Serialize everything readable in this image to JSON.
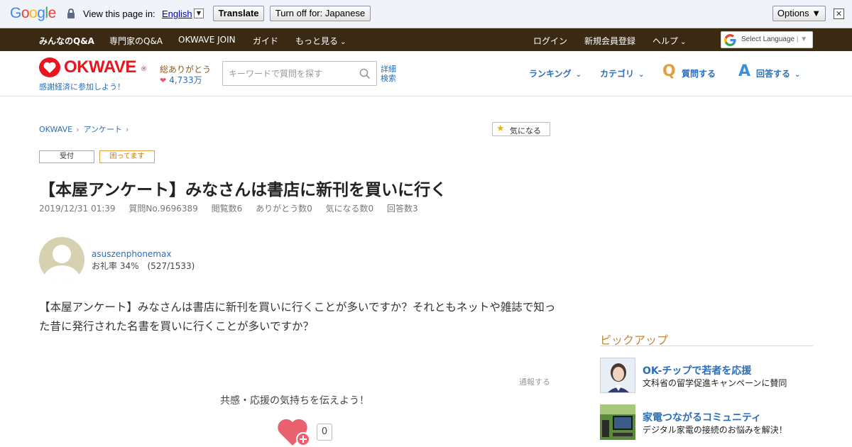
{
  "translate_bar": {
    "logo_letters": [
      "G",
      "o",
      "o",
      "g",
      "l",
      "e"
    ],
    "logo_colors": [
      "#4285f4",
      "#ea4335",
      "#fbbc05",
      "#4285f4",
      "#34a853",
      "#ea4335"
    ],
    "prompt": "View this page in:",
    "language": "English",
    "translate_label": "Translate",
    "turn_off_label": "Turn off for: Japanese",
    "options_label": "Options ▼",
    "close_glyph": "✕"
  },
  "topnav": {
    "items": [
      {
        "label": "みんなのQ&A"
      },
      {
        "label": "専門家のQ&A"
      },
      {
        "label": "OKWAVE JOIN"
      },
      {
        "label": "ガイド"
      },
      {
        "label": "もっと見る"
      },
      {
        "label": "ログイン"
      },
      {
        "label": "新規会員登録"
      },
      {
        "label": "ヘルプ"
      }
    ],
    "select_language": "Select Language"
  },
  "header": {
    "logo_text": "OKWAVE",
    "logo_reg": "®",
    "tagline": "感謝経済に参加しよう！",
    "thanks_label": "総ありがとう",
    "thanks_count": "4,733万",
    "search_placeholder": "キーワードで質問を探す",
    "advanced_search_line1": "詳細",
    "advanced_search_line2": "検索",
    "nav": {
      "ranking": "ランキング",
      "category": "カテゴリ",
      "ask": "質問する",
      "answer": "回答する",
      "q_letter": "Q",
      "a_letter": "A"
    }
  },
  "breadcrumb": [
    "OKWAVE",
    "アンケート"
  ],
  "watch_button": "気になる",
  "badges": {
    "open": "受付",
    "trouble": "困ってます"
  },
  "question": {
    "title": "【本屋アンケート】みなさんは書店に新刊を買いに行く",
    "date": "2019/12/31 01:39",
    "number": "質問No.9696389",
    "views": "閲覧数6",
    "thanks": "ありがとう数0",
    "watch": "気になる数0",
    "answers": "回答数3",
    "body": "【本屋アンケート】みなさんは書店に新刊を買いに行くことが多いですか？それともネットや雑誌で知った昔に発行された名書を買いに行くことが多いですか？"
  },
  "user": {
    "name": "asuszenphonemax",
    "rate": "お礼率 34%　(527/1533)"
  },
  "report_label": "通報する",
  "cheer_text": "共感・応援の気持ちを伝えよう！",
  "cheer_count": "0",
  "sidebar": {
    "pickup_title": "ピックアップ",
    "items": [
      {
        "title": "OK-チップで若者を応援",
        "sub": "文科省の留学促進キャンペーンに賛同"
      },
      {
        "title": "家電つながるコミュニティ",
        "sub": "デジタル家電の接続のお悩みを解決！"
      }
    ]
  },
  "colors": {
    "brand_red": "#e8151f",
    "link_blue": "#2a6fb7",
    "topnav_bg": "#3a2a14",
    "pickup_gold": "#c08a3a"
  }
}
